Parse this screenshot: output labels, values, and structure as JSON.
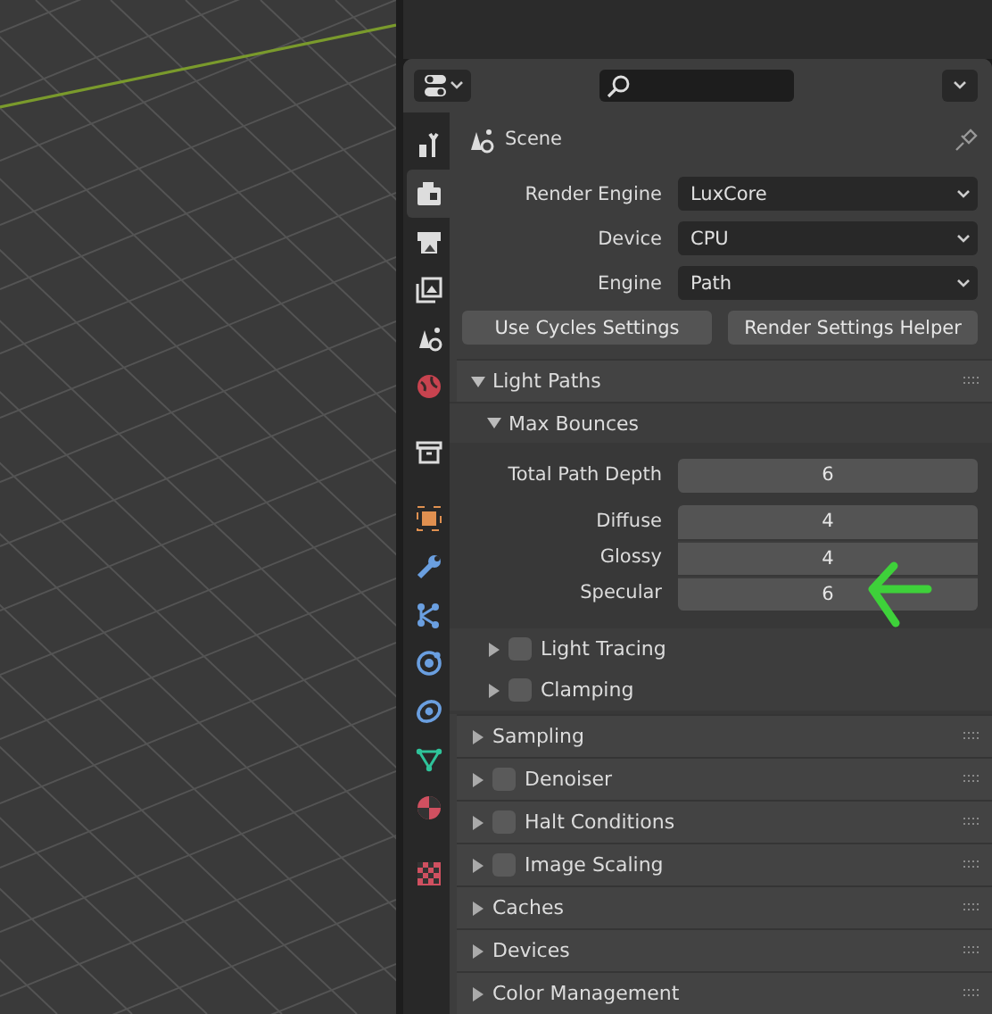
{
  "tab_groups": [
    [
      {
        "kind": "tool",
        "selected": false
      },
      {
        "kind": "render",
        "selected": true
      },
      {
        "kind": "output",
        "selected": false
      },
      {
        "kind": "view_layer",
        "selected": false
      },
      {
        "kind": "scene",
        "selected": false
      },
      {
        "kind": "world",
        "selected": false
      }
    ],
    [
      {
        "kind": "collection",
        "selected": false
      }
    ],
    [
      {
        "kind": "object",
        "selected": false
      },
      {
        "kind": "modifier",
        "selected": false
      },
      {
        "kind": "particles",
        "selected": false
      },
      {
        "kind": "physics",
        "selected": false
      },
      {
        "kind": "constraints",
        "selected": false
      },
      {
        "kind": "data",
        "selected": false
      },
      {
        "kind": "material",
        "selected": false
      }
    ],
    [
      {
        "kind": "texture",
        "selected": false
      }
    ]
  ],
  "context": {
    "label": "Scene"
  },
  "render_settings": [
    {
      "label": "Render Engine",
      "value": "LuxCore"
    },
    {
      "label": "Device",
      "value": "CPU"
    },
    {
      "label": "Engine",
      "value": "Path"
    }
  ],
  "buttons": [
    "Use Cycles Settings",
    "Render Settings Helper"
  ],
  "panels": [
    {
      "title": "Light Paths",
      "expanded": true,
      "subpanels": [
        {
          "title": "Max Bounces",
          "expanded": true,
          "field_groups": [
            [
              {
                "label": "Total Path Depth",
                "value": "6"
              }
            ],
            [
              {
                "label": "Diffuse",
                "value": "4"
              },
              {
                "label": "Glossy",
                "value": "4"
              },
              {
                "label": "Specular",
                "value": "6"
              }
            ]
          ]
        },
        {
          "title": "Light Tracing",
          "expanded": false,
          "checked": false
        },
        {
          "title": "Clamping",
          "expanded": false,
          "checked": false
        }
      ]
    },
    {
      "title": "Sampling",
      "expanded": false
    },
    {
      "title": "Denoiser",
      "expanded": false,
      "checked": false
    },
    {
      "title": "Halt Conditions",
      "expanded": false,
      "checked": false
    },
    {
      "title": "Image Scaling",
      "expanded": false,
      "checked": false
    },
    {
      "title": "Caches",
      "expanded": false
    },
    {
      "title": "Devices",
      "expanded": false
    },
    {
      "title": "Color Management",
      "expanded": false
    }
  ]
}
